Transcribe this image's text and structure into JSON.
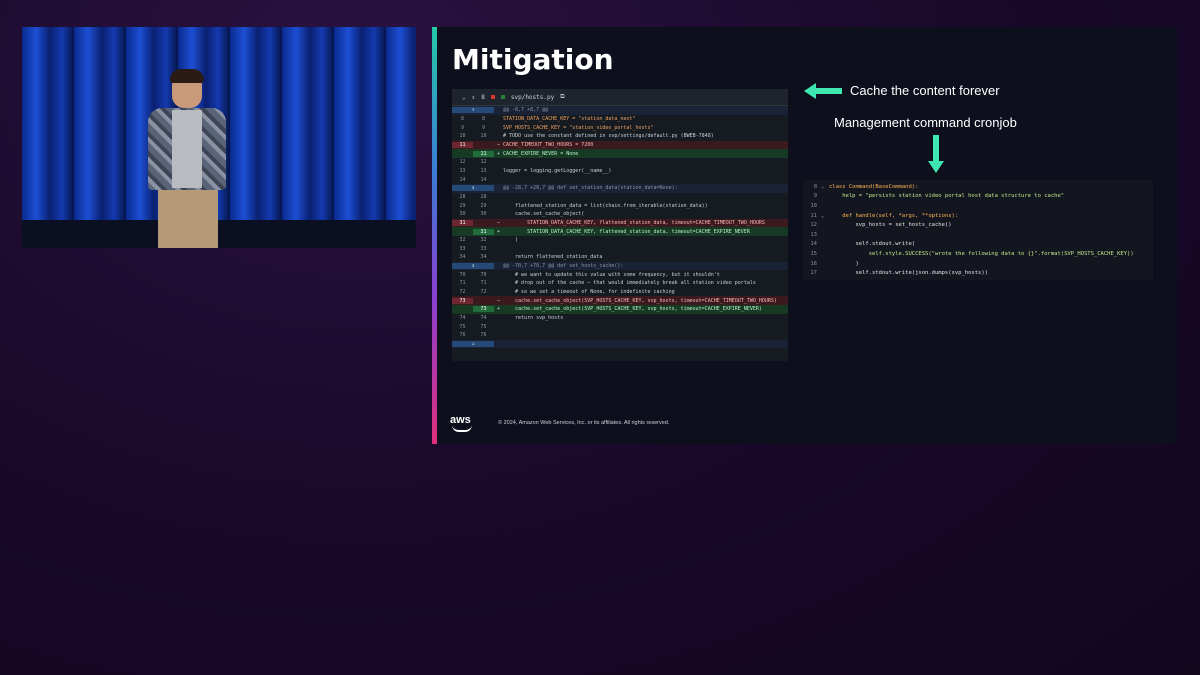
{
  "slide": {
    "title": "Mitigation",
    "callout_cache": "Cache the content forever",
    "callout_cronjob": "Management command cronjob",
    "footer": "© 2024, Amazon Web Services, Inc. or its affiliates. All rights reserved.",
    "logo": "aws",
    "accent_color": "#3ee6b0"
  },
  "diff": {
    "file": "svp/hosts.py",
    "header_count": "8",
    "rows": [
      {
        "type": "hunk",
        "n1": "↑",
        "n2": "",
        "sign": "",
        "code": "@@ -8,7 +8,7 @@"
      },
      {
        "type": "ctx",
        "n1": "8",
        "n2": "8",
        "sign": "",
        "code": "STATION_DATA_CACHE_KEY = \"station_data_next\""
      },
      {
        "type": "ctx",
        "n1": "9",
        "n2": "9",
        "sign": "",
        "code": "SVP_HOSTS_CACHE_KEY = \"station_video_portal_hosts\""
      },
      {
        "type": "ctx",
        "n1": "10",
        "n2": "10",
        "sign": "",
        "code": "# TODO use the constant defined in svp/settings/default.py (BWEB-7848)"
      },
      {
        "type": "del",
        "n1": "11",
        "n2": "",
        "sign": "−",
        "code": "CACHE_TIMEOUT_TWO_HOURS = 7200"
      },
      {
        "type": "add",
        "n1": "",
        "n2": "11",
        "sign": "+",
        "code": "CACHE_EXPIRE_NEVER = None"
      },
      {
        "type": "ctx",
        "n1": "12",
        "n2": "12",
        "sign": "",
        "code": ""
      },
      {
        "type": "ctx",
        "n1": "13",
        "n2": "13",
        "sign": "",
        "code": "logger = logging.getLogger(__name__)"
      },
      {
        "type": "ctx",
        "n1": "14",
        "n2": "14",
        "sign": "",
        "code": ""
      },
      {
        "type": "hunk",
        "n1": "↕",
        "n2": "",
        "sign": "",
        "code": "@@ -28,7 +28,7 @@ def set_station_data(station_data=None):"
      },
      {
        "type": "ctx",
        "n1": "28",
        "n2": "28",
        "sign": "",
        "code": ""
      },
      {
        "type": "ctx",
        "n1": "29",
        "n2": "29",
        "sign": "",
        "code": "    flattened_station_data = list(chain.from_iterable(station_data))"
      },
      {
        "type": "ctx",
        "n1": "30",
        "n2": "30",
        "sign": "",
        "code": "    cache.set_cache_object("
      },
      {
        "type": "del",
        "n1": "31",
        "n2": "",
        "sign": "−",
        "code": "        STATION_DATA_CACHE_KEY, flattened_station_data, timeout=CACHE_TIMEOUT_TWO_HOURS"
      },
      {
        "type": "add",
        "n1": "",
        "n2": "31",
        "sign": "+",
        "code": "        STATION_DATA_CACHE_KEY, flattened_station_data, timeout=CACHE_EXPIRE_NEVER"
      },
      {
        "type": "ctx",
        "n1": "32",
        "n2": "32",
        "sign": "",
        "code": "    )"
      },
      {
        "type": "ctx",
        "n1": "33",
        "n2": "33",
        "sign": "",
        "code": ""
      },
      {
        "type": "ctx",
        "n1": "34",
        "n2": "34",
        "sign": "",
        "code": "    return flattened_station_data"
      },
      {
        "type": "hunk",
        "n1": "↕",
        "n2": "",
        "sign": "",
        "code": "@@ -70,7 +70,7 @@ def set_hosts_cache():"
      },
      {
        "type": "ctx",
        "n1": "70",
        "n2": "70",
        "sign": "",
        "code": "    # we want to update this value with some frequency, but it shouldn't"
      },
      {
        "type": "ctx",
        "n1": "71",
        "n2": "71",
        "sign": "",
        "code": "    # drop out of the cache — that would immediately break all station video portals"
      },
      {
        "type": "ctx",
        "n1": "72",
        "n2": "72",
        "sign": "",
        "code": "    # so we set a timeout of None, for indefinite caching"
      },
      {
        "type": "del",
        "n1": "73",
        "n2": "",
        "sign": "−",
        "code": "    cache.set_cache_object(SVP_HOSTS_CACHE_KEY, svp_hosts, timeout=CACHE_TIMEOUT_TWO_HOURS)"
      },
      {
        "type": "add",
        "n1": "",
        "n2": "73",
        "sign": "+",
        "code": "    cache.set_cache_object(SVP_HOSTS_CACHE_KEY, svp_hosts, timeout=CACHE_EXPIRE_NEVER)"
      },
      {
        "type": "ctx",
        "n1": "74",
        "n2": "74",
        "sign": "",
        "code": "    return svp_hosts"
      },
      {
        "type": "ctx",
        "n1": "75",
        "n2": "75",
        "sign": "",
        "code": ""
      },
      {
        "type": "ctx",
        "n1": "76",
        "n2": "76",
        "sign": "",
        "code": ""
      },
      {
        "type": "hunk",
        "n1": "↓",
        "n2": "",
        "sign": "",
        "code": ""
      }
    ]
  },
  "command": {
    "lines": [
      {
        "n": "8",
        "fold": "⌄",
        "code": "class Command(BaseCommand):"
      },
      {
        "n": "9",
        "fold": "",
        "code": "    help = \"persists station video portal host data structure to cache\""
      },
      {
        "n": "10",
        "fold": "",
        "code": ""
      },
      {
        "n": "11",
        "fold": "⌄",
        "code": "    def handle(self, *args, **options):"
      },
      {
        "n": "12",
        "fold": "",
        "code": "        svp_hosts = set_hosts_cache()"
      },
      {
        "n": "13",
        "fold": "",
        "code": ""
      },
      {
        "n": "14",
        "fold": "",
        "code": "        self.stdout.write("
      },
      {
        "n": "15",
        "fold": "",
        "code": "            self.style.SUCCESS(\"wrote the following data to {}\".format(SVP_HOSTS_CACHE_KEY))"
      },
      {
        "n": "16",
        "fold": "",
        "code": "        )"
      },
      {
        "n": "17",
        "fold": "",
        "code": "        self.stdout.write(json.dumps(svp_hosts))"
      }
    ]
  }
}
